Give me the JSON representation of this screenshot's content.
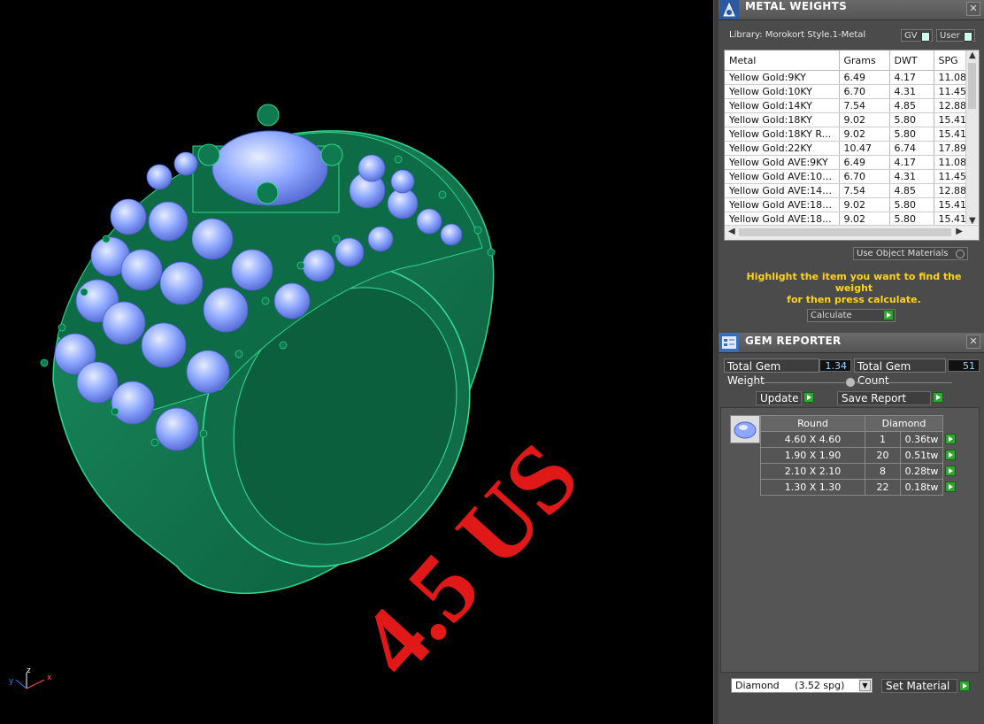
{
  "viewport": {
    "size_text": "4.5 US",
    "axes": {
      "y": "y",
      "z": "z",
      "x": "x"
    }
  },
  "metal_weights": {
    "title": "METAL WEIGHTS",
    "library_label": "Library: Morokort Style.1-Metal",
    "gv_label": "GV",
    "user_label": "User",
    "columns": [
      "Metal",
      "Grams",
      "DWT",
      "SPG"
    ],
    "rows": [
      [
        "Yellow Gold:9KY",
        "6.49",
        "4.17",
        "11.08"
      ],
      [
        "Yellow Gold:10KY",
        "6.70",
        "4.31",
        "11.45"
      ],
      [
        "Yellow Gold:14KY",
        "7.54",
        "4.85",
        "12.88"
      ],
      [
        "Yellow Gold:18KY",
        "9.02",
        "5.80",
        "15.41"
      ],
      [
        "Yellow Gold:18KY R...",
        "9.02",
        "5.80",
        "15.41"
      ],
      [
        "Yellow Gold:22KY",
        "10.47",
        "6.74",
        "17.89"
      ],
      [
        "Yellow Gold AVE:9KY",
        "6.49",
        "4.17",
        "11.08"
      ],
      [
        "Yellow Gold AVE:10KY",
        "6.70",
        "4.31",
        "11.45"
      ],
      [
        "Yellow Gold AVE:14KY",
        "7.54",
        "4.85",
        "12.88"
      ],
      [
        "Yellow Gold AVE:18KY",
        "9.02",
        "5.80",
        "15.41"
      ],
      [
        "Yellow Gold AVE:18...",
        "9.02",
        "5.80",
        "15.41"
      ]
    ],
    "use_object_materials": "Use Object Materials",
    "hint_line1": "Highlight the item you want to find the weight",
    "hint_line2": "for then press calculate.",
    "calculate_label": "Calculate"
  },
  "gem_reporter": {
    "title": "GEM REPORTER",
    "total_weight_label": "Total Gem Weight",
    "total_weight_value": "1.34",
    "total_count_label": "Total Gem Count",
    "total_count_value": "51",
    "update_label": "Update",
    "save_report_label": "Save Report",
    "header_shape": "Round",
    "header_material": "Diamond",
    "rows": [
      [
        "4.60 X 4.60",
        "1",
        "0.36tw"
      ],
      [
        "1.90 X 1.90",
        "20",
        "0.51tw"
      ],
      [
        "2.10 X 2.10",
        "8",
        "0.28tw"
      ],
      [
        "1.30 X 1.30",
        "22",
        "0.18tw"
      ]
    ],
    "material_select": "Diamond     (3.52 spg)",
    "set_material_label": "Set Material"
  },
  "colors": {
    "ring": "#1f8a5a",
    "gem": "#8aa6ff",
    "size_text": "#e01818",
    "hint": "#ffd31a"
  }
}
